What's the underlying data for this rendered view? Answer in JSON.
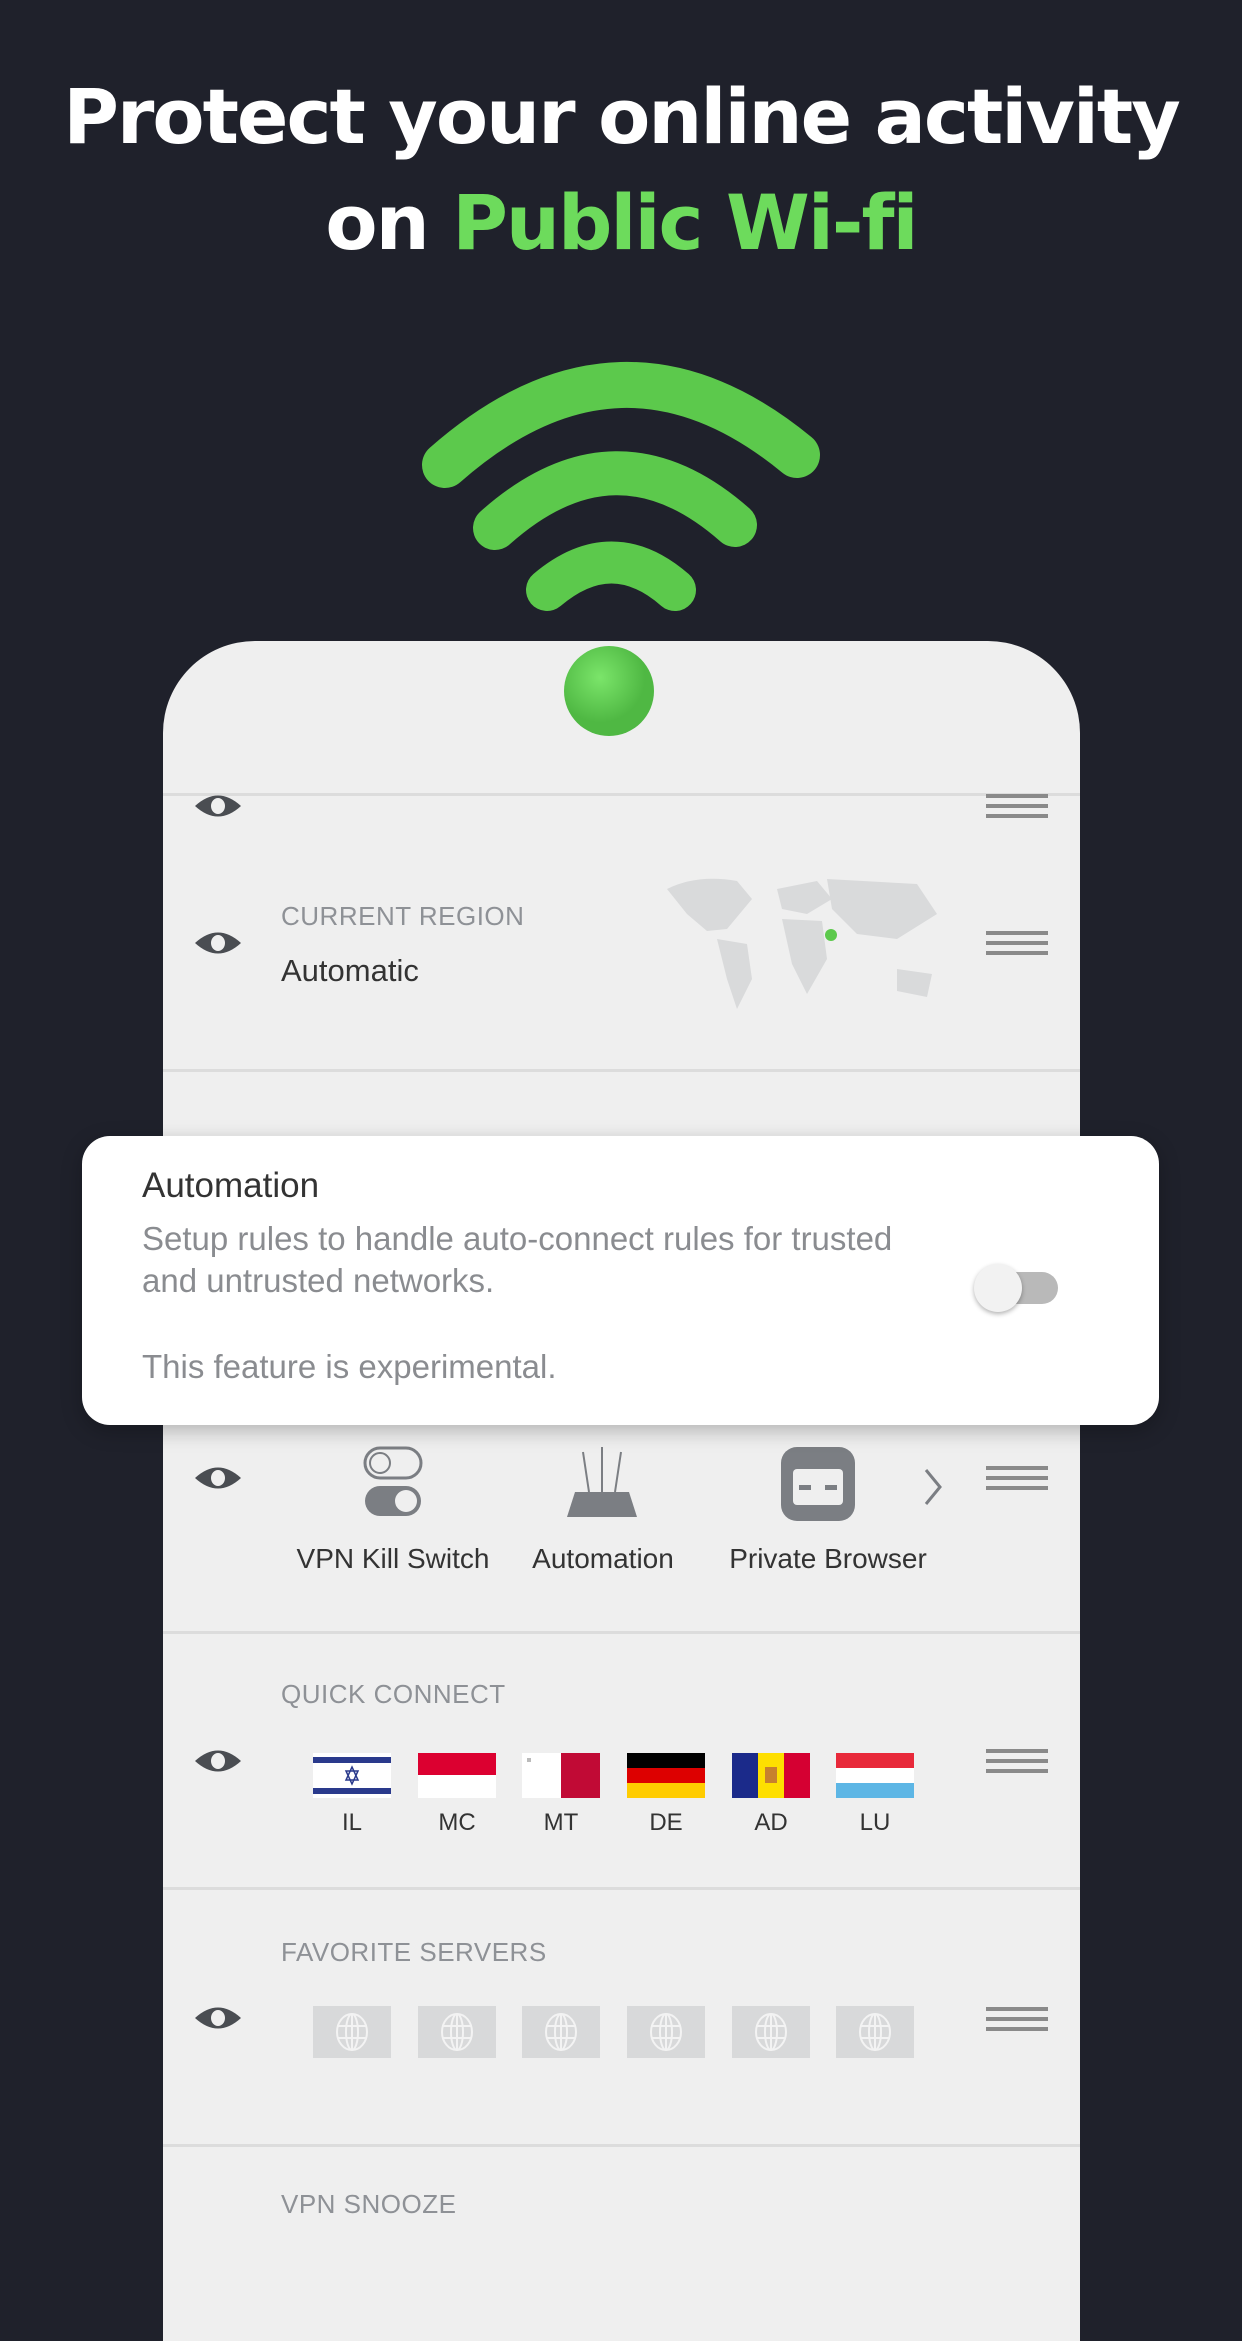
{
  "headline": {
    "line1": "Protect your online activity",
    "line2_prefix": "on ",
    "line2_accent": "Public Wi-fi"
  },
  "colors": {
    "accent": "#6ddb5c",
    "background": "#1f212b",
    "card": "#efefef"
  },
  "sections": {
    "current_region": {
      "label": "CURRENT REGION",
      "value": "Automatic"
    },
    "features": {
      "items": [
        {
          "label": "VPN Kill Switch",
          "icon": "kill-switch-icon"
        },
        {
          "label": "Automation",
          "icon": "router-icon"
        },
        {
          "label": "Private Browser",
          "icon": "incognito-icon"
        }
      ]
    },
    "quick_connect": {
      "label": "QUICK CONNECT",
      "countries": [
        "IL",
        "MC",
        "MT",
        "DE",
        "AD",
        "LU"
      ]
    },
    "favorite_servers": {
      "label": "FAVORITE SERVERS",
      "slots": 6
    },
    "vpn_snooze": {
      "label": "VPN SNOOZE"
    }
  },
  "popup": {
    "title": "Automation",
    "description": "Setup rules to handle auto-connect rules for trusted and untrusted networks.",
    "note": "This feature is experimental.",
    "toggle_on": false
  }
}
